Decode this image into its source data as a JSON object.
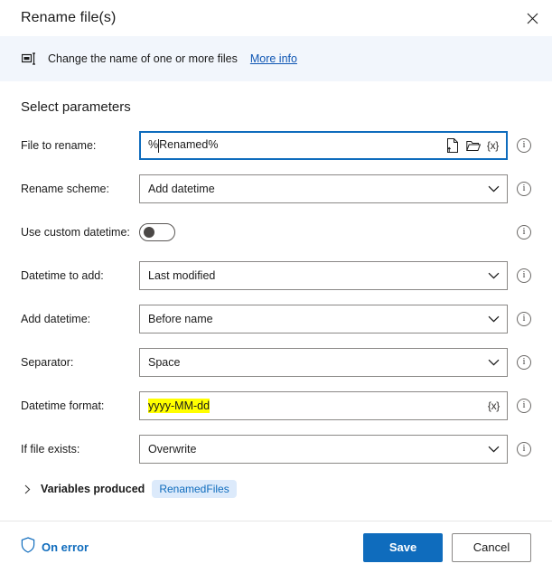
{
  "window": {
    "title": "Rename file(s)",
    "close_icon": "close-icon"
  },
  "banner": {
    "icon": "rename-icon",
    "text": "Change the name of one or more files",
    "link_label": "More info"
  },
  "main": {
    "section_title": "Select parameters",
    "fields": [
      {
        "label": "File to rename:",
        "type": "textfield",
        "value": "%Renamed%",
        "focused": true,
        "caret_after": 1,
        "icons": [
          "select-file-icon",
          "select-folder-icon",
          "variable-icon"
        ]
      },
      {
        "label": "Rename scheme:",
        "type": "dropdown",
        "value": "Add datetime"
      },
      {
        "label": "Use custom datetime:",
        "type": "toggle",
        "value": "off"
      },
      {
        "label": "Datetime to add:",
        "type": "dropdown",
        "value": "Last modified"
      },
      {
        "label": "Add datetime:",
        "type": "dropdown",
        "value": "Before name"
      },
      {
        "label": "Separator:",
        "type": "dropdown",
        "value": "Space"
      },
      {
        "label": "Datetime format:",
        "type": "textfield",
        "value": "yyyy-MM-dd",
        "highlighted": true,
        "icons": [
          "variable-icon"
        ]
      },
      {
        "label": "If file exists:",
        "type": "dropdown",
        "value": "Overwrite"
      }
    ],
    "variables_produced": {
      "label": "Variables produced",
      "chip": "RenamedFiles",
      "expanded": false
    }
  },
  "footer": {
    "on_error_label": "On error",
    "on_error_icon": "shield-icon",
    "save_label": "Save",
    "cancel_label": "Cancel"
  },
  "colors": {
    "accent": "#0f6cbd",
    "banner_bg": "#f2f6fc",
    "highlight": "#ffff00",
    "chip_bg": "#dceafb",
    "border": "#8a8886"
  }
}
